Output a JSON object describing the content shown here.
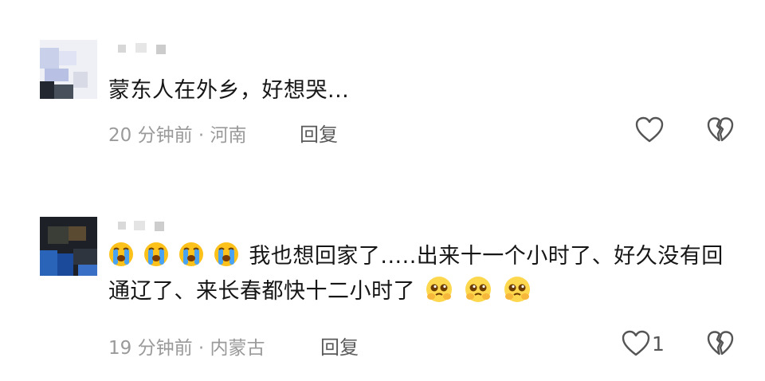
{
  "comments": [
    {
      "text": "蒙东人在外乡，好想哭...",
      "time": "20 分钟前",
      "separator": "·",
      "location": "河南",
      "reply_label": "回复",
      "like_icon": "heart-outline-icon",
      "dislike_icon": "broken-heart-icon"
    },
    {
      "leading_emojis": [
        "loudly-crying-face",
        "loudly-crying-face",
        "loudly-crying-face",
        "loudly-crying-face"
      ],
      "text": "我也想回家了.....出来十一个小时了、好久没有回通辽了、来长春都快十二小时了",
      "trailing_emojis": [
        "pleading-face",
        "pleading-face",
        "pleading-face"
      ],
      "time": "19 分钟前",
      "separator": "·",
      "location": "内蒙古",
      "reply_label": "回复",
      "like_count": "1",
      "like_icon": "heart-outline-icon",
      "dislike_icon": "broken-heart-icon"
    }
  ],
  "colors": {
    "text": "#161616",
    "meta": "#9a9a9a",
    "reply": "#5a5a5a",
    "icon_stroke": "#555555"
  }
}
